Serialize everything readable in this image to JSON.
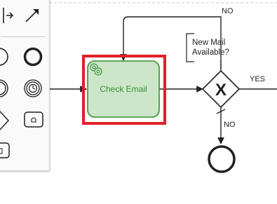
{
  "task": {
    "label": "Check Email",
    "type_icon": "gear-icon",
    "fill": "#cbe6c8",
    "stroke": "#4a9a46",
    "text_color": "#3f8f3a",
    "selected": true,
    "selection_color": "#e0202a"
  },
  "annotation": {
    "line1": "New Mail",
    "line2": "Available?"
  },
  "gateway": {
    "type": "exclusive",
    "marker": "X"
  },
  "flows": {
    "loop_label": "NO",
    "yes_label": "YES",
    "down_label": "NO"
  },
  "palette": {
    "tools": [
      "space-tool-icon",
      "connect-tool-icon",
      "start-event-icon",
      "end-event-icon",
      "intermediate-event-icon",
      "timer-event-icon",
      "gateway-icon",
      "task-icon",
      "subprocess-icon"
    ]
  }
}
